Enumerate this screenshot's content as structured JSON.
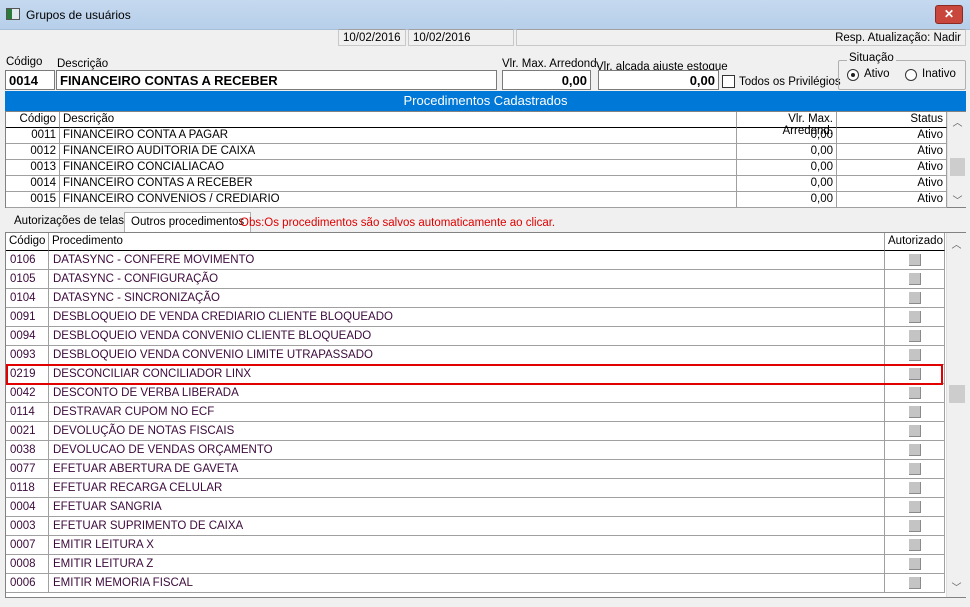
{
  "window": {
    "title": "Grupos de usuários",
    "close_label": "✕"
  },
  "status": {
    "date1": "10/02/2016",
    "date2": "10/02/2016",
    "blank": "",
    "resp": "Resp. Atualização: Nadir"
  },
  "form": {
    "codigo_label": "Código",
    "codigo": "0014",
    "descricao_label": "Descrição",
    "descricao": "FINANCEIRO CONTAS A RECEBER",
    "vlr_max_label": "Vlr. Max. Arredond.",
    "vlr_max": "0,00",
    "vlr_alcada_label": "Vlr. alçada ajuste estoque",
    "vlr_alcada": "0,00",
    "todos_label": "Todos os Privilégios",
    "todos_checked": false,
    "situacao_label": "Situação",
    "ativo_label": "Ativo",
    "inativo_label": "Inativo",
    "situacao": "Ativo"
  },
  "procedimentos_cadastrados": {
    "title": "Procedimentos Cadastrados",
    "columns": [
      "Código",
      "Descrição",
      "Vlr. Max. Arredond.",
      "Status"
    ],
    "rows": [
      [
        "0011",
        "FINANCEIRO CONTA A PAGAR",
        "0,00",
        "Ativo"
      ],
      [
        "0012",
        "FINANCEIRO AUDITORIA DE CAIXA",
        "0,00",
        "Ativo"
      ],
      [
        "0013",
        "FINANCEIRO CONCIALIACAO",
        "0,00",
        "Ativo"
      ],
      [
        "0014",
        "FINANCEIRO CONTAS A RECEBER",
        "0,00",
        "Ativo"
      ],
      [
        "0015",
        "FINANCEIRO CONVENIOS / CREDIARIO",
        "0,00",
        "Ativo"
      ]
    ]
  },
  "tabs": [
    {
      "label": "Autorizações de telas",
      "selected": false
    },
    {
      "label": "Outros procedimentos",
      "selected": true
    }
  ],
  "obs": "Obs:Os procedimentos são salvos automaticamente ao clicar.",
  "outros": {
    "columns": [
      "Código",
      "Procedimento",
      "Autorizado"
    ],
    "highlighted_code": "0219",
    "rows": [
      [
        "0106",
        "DATASYNC - CONFERE MOVIMENTO"
      ],
      [
        "0105",
        "DATASYNC - CONFIGURAÇÃO"
      ],
      [
        "0104",
        "DATASYNC - SINCRONIZAÇÃO"
      ],
      [
        "0091",
        "DESBLOQUEIO DE VENDA CREDIARIO CLIENTE BLOQUEADO"
      ],
      [
        "0094",
        "DESBLOQUEIO VENDA CONVENIO CLIENTE BLOQUEADO"
      ],
      [
        "0093",
        "DESBLOQUEIO VENDA CONVENIO LIMITE UTRAPASSADO"
      ],
      [
        "0219",
        "DESCONCILIAR CONCILIADOR LINX"
      ],
      [
        "0042",
        "DESCONTO DE VERBA LIBERADA"
      ],
      [
        "0114",
        "DESTRAVAR CUPOM NO ECF"
      ],
      [
        "0021",
        "DEVOLUÇÃO DE NOTAS FISCAIS"
      ],
      [
        "0038",
        "DEVOLUCAO DE VENDAS ORÇAMENTO"
      ],
      [
        "0077",
        "EFETUAR ABERTURA DE GAVETA"
      ],
      [
        "0118",
        "EFETUAR RECARGA CELULAR"
      ],
      [
        "0004",
        "EFETUAR SANGRIA"
      ],
      [
        "0003",
        "EFETUAR SUPRIMENTO DE CAIXA"
      ],
      [
        "0007",
        "EMITIR LEITURA X"
      ],
      [
        "0008",
        "EMITIR LEITURA Z"
      ],
      [
        "0006",
        "EMITIR MEMORIA FISCAL"
      ]
    ]
  }
}
